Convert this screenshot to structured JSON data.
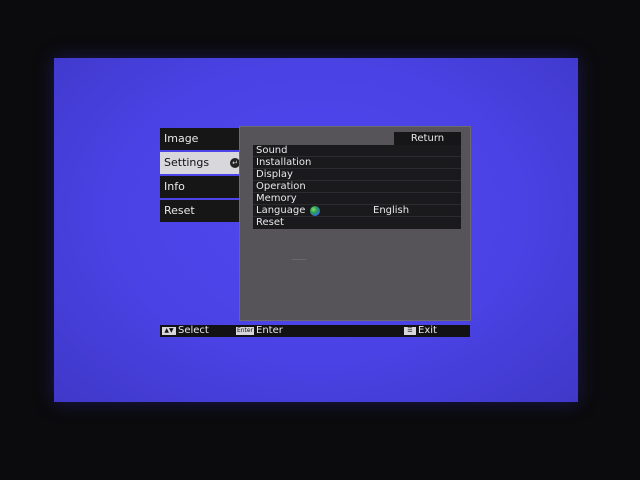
{
  "sidebar": {
    "items": [
      {
        "label": "Image"
      },
      {
        "label": "Settings",
        "active": true
      },
      {
        "label": "Info"
      },
      {
        "label": "Reset"
      }
    ]
  },
  "panel": {
    "return_label": "Return",
    "items": [
      {
        "label": "Sound"
      },
      {
        "label": "Installation"
      },
      {
        "label": "Display"
      },
      {
        "label": "Operation"
      },
      {
        "label": "Memory"
      },
      {
        "label": "Language",
        "value": "English",
        "icon": "globe-icon"
      },
      {
        "label": "Reset"
      }
    ]
  },
  "footer": {
    "select_label": "Select",
    "enter_key": "Enter",
    "enter_label": "Enter",
    "exit_label": "Exit"
  },
  "colors": {
    "screen_background": "#4a42e4",
    "panel": "#565458",
    "menu_item": "#161616",
    "active_tab": "#d8d8dc"
  }
}
